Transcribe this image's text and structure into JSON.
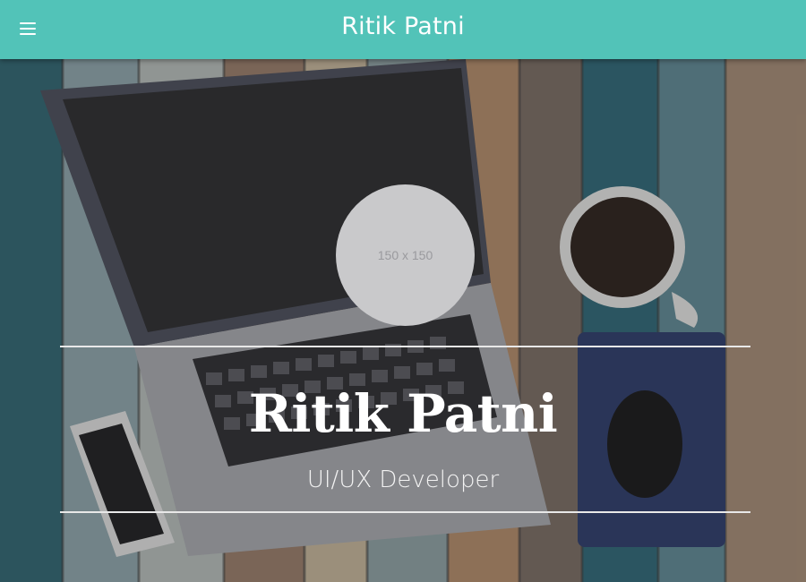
{
  "appbar": {
    "title": "Ritik Patni",
    "menu_icon": "hamburger-menu-icon",
    "background": "#52c3b8"
  },
  "hero": {
    "avatar_placeholder": "150 x 150",
    "name": "Ritik Patni",
    "role": "UI/UX Developer",
    "rule_color": "#e8e8e8"
  },
  "colors": {
    "accent": "#52c3b8",
    "text_on_hero": "#ffffff"
  }
}
